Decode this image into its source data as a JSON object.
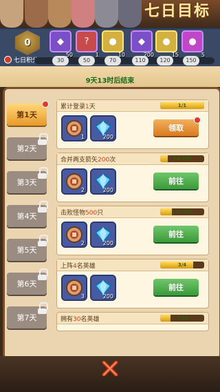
{
  "header": {
    "title": "七日目标"
  },
  "progress": {
    "current_points": "0",
    "rewards": [
      {
        "icon": "purple-gem-icon",
        "count": "50",
        "color": "#7a4fc8"
      },
      {
        "icon": "red-mystery-box-icon",
        "count": "1",
        "color": "#c84a4a"
      },
      {
        "icon": "wolf-card-icon",
        "count": "10",
        "color": "#d4b040"
      },
      {
        "icon": "purple-gem-icon",
        "count": "200",
        "color": "#7a4fc8"
      },
      {
        "icon": "wolf-card-icon",
        "count": "15",
        "color": "#d4b040"
      },
      {
        "icon": "purple-monster-card-icon",
        "count": "5",
        "color": "#c048c8"
      }
    ],
    "points_label": "七日积分",
    "thresholds": [
      "30",
      "50",
      "70",
      "110",
      "120",
      "150"
    ]
  },
  "timer": {
    "text": "9天13时后结束"
  },
  "days": [
    {
      "label": "第1天",
      "active": true,
      "locked": false
    },
    {
      "label": "第2天",
      "active": false,
      "locked": true
    },
    {
      "label": "第3天",
      "active": false,
      "locked": true
    },
    {
      "label": "第4天",
      "active": false,
      "locked": true
    },
    {
      "label": "第5天",
      "active": false,
      "locked": true
    },
    {
      "label": "第6天",
      "active": false,
      "locked": true
    },
    {
      "label": "第7天",
      "active": false,
      "locked": true
    }
  ],
  "tasks": [
    {
      "name_pre": "累计登录",
      "name_hl": "1",
      "name_post": "天",
      "progress": "1/1",
      "ratio": 1.0,
      "items": [
        {
          "icon": "scroll-chest-icon",
          "count": "1"
        },
        {
          "icon": "diamond-icon",
          "count": "200"
        }
      ],
      "button": "领取",
      "button_type": "claim"
    },
    {
      "name_pre": "合并两支箭矢",
      "name_hl": "200",
      "name_post": "次",
      "progress": "34/200",
      "ratio": 0.17,
      "items": [
        {
          "icon": "scroll-chest-icon",
          "count": "2"
        },
        {
          "icon": "diamond-icon",
          "count": "200"
        }
      ],
      "button": "前往",
      "button_type": "go"
    },
    {
      "name_pre": "击败怪物",
      "name_hl": "500",
      "name_post": "只",
      "progress": "131/500",
      "ratio": 0.262,
      "items": [
        {
          "icon": "scroll-chest-icon",
          "count": "2"
        },
        {
          "icon": "diamond-icon",
          "count": "200"
        }
      ],
      "button": "前往",
      "button_type": "go"
    },
    {
      "name_pre": "上阵",
      "name_hl": "4",
      "name_post": "名英雄",
      "progress": "3/4",
      "ratio": 0.75,
      "items": [
        {
          "icon": "scroll-chest-icon",
          "count": "3"
        },
        {
          "icon": "diamond-icon",
          "count": "200"
        }
      ],
      "button": "前往",
      "button_type": "go"
    },
    {
      "name_pre": "拥有",
      "name_hl": "30",
      "name_post": "名英雄",
      "progress": "7/30",
      "ratio": 0.233,
      "items": [],
      "button": "",
      "button_type": "none"
    }
  ],
  "colors": {
    "accent_orange": "#e89a2a",
    "claim_button": "#d97a22",
    "go_button": "#3b9a3a",
    "highlight_red": "#d0441a"
  }
}
